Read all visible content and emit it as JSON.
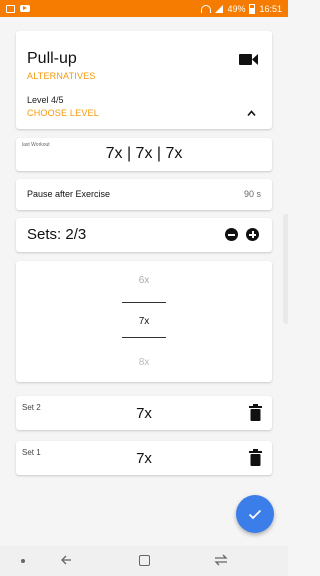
{
  "status_bar": {
    "battery": "49%",
    "time": "16:51"
  },
  "exercise": {
    "title": "Pull-up",
    "alternatives_label": "ALTERNATIVES",
    "level": "Level 4/5",
    "choose_level_label": "CHOOSE LEVEL"
  },
  "last_workout": {
    "label": "last Workout",
    "value": "7x | 7x | 7x"
  },
  "pause": {
    "label": "Pause after Exercise",
    "value": "90 s"
  },
  "sets": {
    "label": "Sets: 2/3"
  },
  "picker": {
    "previous": "6x",
    "current": "7x",
    "next": "8x"
  },
  "completed_sets": [
    {
      "label": "Set 2",
      "value": "7x"
    },
    {
      "label": "Set 1",
      "value": "7x"
    }
  ],
  "icons": {
    "video": "video-camera-icon",
    "chevron": "chevron-up-icon",
    "minus": "minus-circle-icon",
    "plus": "plus-circle-icon",
    "trash": "trash-icon",
    "fab": "check-icon"
  },
  "colors": {
    "accent": "#f57c00",
    "link": "#f59a0a",
    "fab": "#3b7de9"
  }
}
